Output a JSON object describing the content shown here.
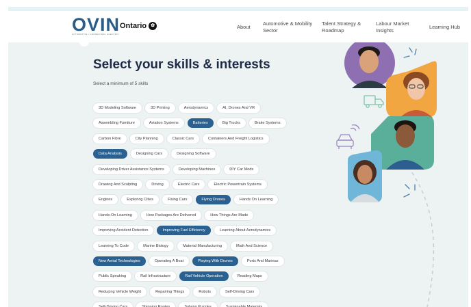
{
  "logo": {
    "word": "OVIN",
    "tagline": "AUTOMOTIVE • CONNECTED • ELECTRIC"
  },
  "partner": "Ontario",
  "nav": [
    {
      "label": "About"
    },
    {
      "label": "Automotive & Mobility Sector"
    },
    {
      "label": "Talent Strategy & Roadmap"
    },
    {
      "label": "Labour Market Insights"
    },
    {
      "label": "Learning Hub"
    }
  ],
  "page": {
    "title": "Select your skills & interests",
    "subtitle": "Select a minimum of 5 skills"
  },
  "skill_rows": [
    [
      {
        "label": "3D Modeling Software",
        "selected": false
      },
      {
        "label": "3D Printing",
        "selected": false
      },
      {
        "label": "Aerodynamics",
        "selected": false
      },
      {
        "label": "AI, Drones And VR",
        "selected": false
      }
    ],
    [
      {
        "label": "Assembling Furniture",
        "selected": false
      },
      {
        "label": "Aviation Systems",
        "selected": false
      },
      {
        "label": "Batteries",
        "selected": true
      },
      {
        "label": "Big Trucks",
        "selected": false
      },
      {
        "label": "Brake Systems",
        "selected": false
      }
    ],
    [
      {
        "label": "Carbon Fibre",
        "selected": false
      },
      {
        "label": "City Planning",
        "selected": false
      },
      {
        "label": "Classic Cars",
        "selected": false
      },
      {
        "label": "Containers And Freight Logistics",
        "selected": false
      }
    ],
    [
      {
        "label": "Data Analysis",
        "selected": true
      },
      {
        "label": "Designing Cars",
        "selected": false
      },
      {
        "label": "Designing Software",
        "selected": false
      }
    ],
    [
      {
        "label": "Developing Driver Assistance Systems",
        "selected": false
      },
      {
        "label": "Developing Machines",
        "selected": false
      },
      {
        "label": "DIY Car Mods",
        "selected": false
      }
    ],
    [
      {
        "label": "Drawing And Sculpting",
        "selected": false
      },
      {
        "label": "Driving",
        "selected": false
      },
      {
        "label": "Electric Cars",
        "selected": false
      },
      {
        "label": "Electric Powertrain Systems",
        "selected": false
      }
    ],
    [
      {
        "label": "Engines",
        "selected": false
      },
      {
        "label": "Exploring Cities",
        "selected": false
      },
      {
        "label": "Fixing Cars",
        "selected": false
      },
      {
        "label": "Flying Drones",
        "selected": true
      },
      {
        "label": "Hands On Learning",
        "selected": false
      }
    ],
    [
      {
        "label": "Hands-On Learning",
        "selected": false
      },
      {
        "label": "How Packages Are Delivered",
        "selected": false
      },
      {
        "label": "How Things Are Made",
        "selected": false
      }
    ],
    [
      {
        "label": "Improving Accident Detection",
        "selected": false
      },
      {
        "label": "Improving Fuel Efficiency",
        "selected": true
      },
      {
        "label": "Learning About Aerodynamics",
        "selected": false
      }
    ],
    [
      {
        "label": "Learning To Code",
        "selected": false
      },
      {
        "label": "Marine Biology",
        "selected": false
      },
      {
        "label": "Material Manufacturing",
        "selected": false
      },
      {
        "label": "Math And Science",
        "selected": false
      }
    ],
    [
      {
        "label": "New Aerial Technologies",
        "selected": true
      },
      {
        "label": "Operating A Boat",
        "selected": false
      },
      {
        "label": "Playing With Drones",
        "selected": true
      },
      {
        "label": "Ports And Marinas",
        "selected": false
      }
    ],
    [
      {
        "label": "Public Speaking",
        "selected": false
      },
      {
        "label": "Rail Infrastructure",
        "selected": false
      },
      {
        "label": "Rail Vehicle Operation",
        "selected": true
      },
      {
        "label": "Reading Maps",
        "selected": false
      }
    ],
    [
      {
        "label": "Reducing Vehicle Weight",
        "selected": false
      },
      {
        "label": "Repairing Things",
        "selected": false
      },
      {
        "label": "Robots",
        "selected": false
      },
      {
        "label": "Self-Driving Cars",
        "selected": false
      }
    ],
    [
      {
        "label": "Self-Driving Cars",
        "selected": false
      },
      {
        "label": "Shipping Routes",
        "selected": false
      },
      {
        "label": "Solving Puzzles",
        "selected": false
      },
      {
        "label": "Sustainable Materials",
        "selected": false
      }
    ]
  ],
  "colors": {
    "accent": "#2a6190",
    "title": "#1d2b46",
    "panel_bg": "#edf2f2",
    "teal": "#5aaf9a",
    "orange": "#f2a641",
    "purple": "#8e6fb2",
    "sky": "#6fb6d8"
  },
  "icons": [
    "ontario-trillium-icon",
    "truck-icon",
    "car-signal-icon",
    "sparkle-icon"
  ]
}
